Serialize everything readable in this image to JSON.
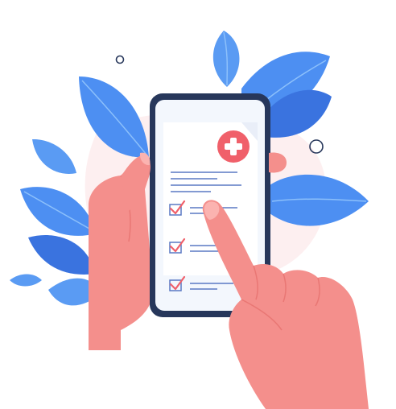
{
  "illustration": {
    "subject": "hand-holding-smartphone-with-medical-checklist",
    "icons": [
      "medical-cross-icon",
      "checkbox-checked-icon"
    ],
    "checklist_items_count": 3,
    "colors": {
      "leaf_blue": "#4d8ff2",
      "leaf_blue_light": "#8cc0fb",
      "leaf_blue_dark": "#3a73df",
      "skin": "#f48f8c",
      "skin_shadow": "#e97774",
      "phone_frame": "#27375b",
      "phone_screen": "#f3f7fd",
      "paper": "#ffffff",
      "accent_red": "#f0606a",
      "line_blue": "#5a79c3",
      "backdrop_pink": "#fdeff0"
    }
  }
}
